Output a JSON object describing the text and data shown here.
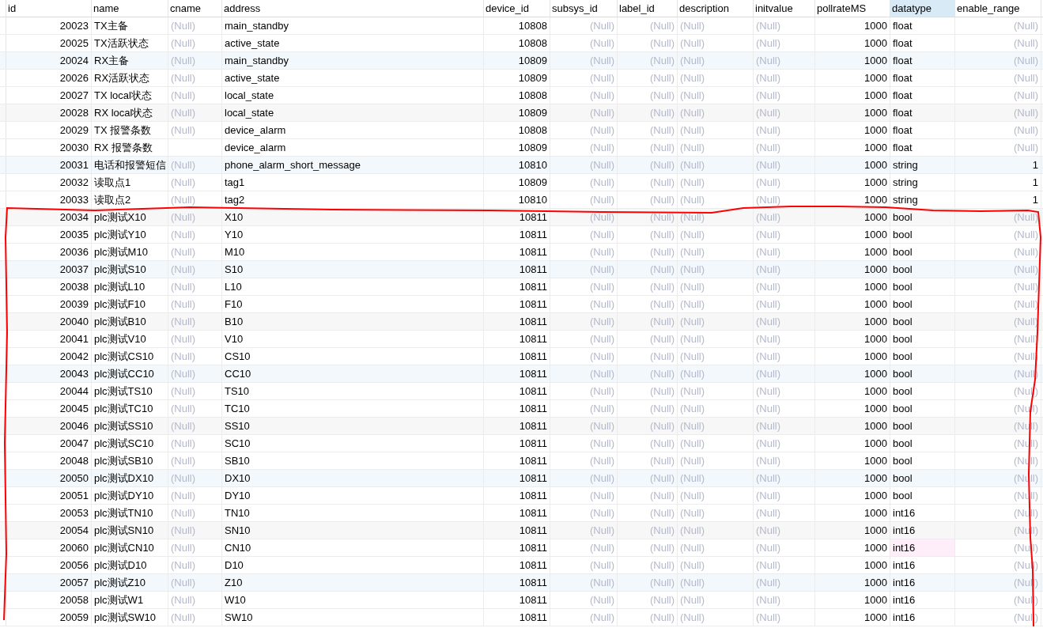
{
  "table": {
    "columns": [
      {
        "label": "id",
        "selected": false
      },
      {
        "label": "name",
        "selected": false
      },
      {
        "label": "cname",
        "selected": false
      },
      {
        "label": "address",
        "selected": false
      },
      {
        "label": "device_id",
        "selected": false
      },
      {
        "label": "subsys_id",
        "selected": false
      },
      {
        "label": "label_id",
        "selected": false
      },
      {
        "label": "description",
        "selected": false
      },
      {
        "label": "initvalue",
        "selected": false
      },
      {
        "label": "pollrateMS",
        "selected": false
      },
      {
        "label": "datatype",
        "selected": true
      },
      {
        "label": "enable_range",
        "selected": false
      }
    ],
    "rows": [
      {
        "cells": [
          "20023",
          "TX主备",
          "(Null)",
          "main_standby",
          "10808",
          "(Null)",
          "(Null)",
          "(Null)",
          "(Null)",
          "1000",
          "float",
          "(Null)"
        ],
        "nulls": [
          false,
          false,
          true,
          false,
          false,
          true,
          true,
          true,
          true,
          false,
          false,
          true
        ],
        "modified": false
      },
      {
        "cells": [
          "20025",
          "TX活跃状态",
          "(Null)",
          "active_state",
          "10808",
          "(Null)",
          "(Null)",
          "(Null)",
          "(Null)",
          "1000",
          "float",
          "(Null)"
        ],
        "nulls": [
          false,
          false,
          true,
          false,
          false,
          true,
          true,
          true,
          true,
          false,
          false,
          true
        ],
        "modified": false
      },
      {
        "cells": [
          "20024",
          "RX主备",
          "(Null)",
          "main_standby",
          "10809",
          "(Null)",
          "(Null)",
          "(Null)",
          "(Null)",
          "1000",
          "float",
          "(Null)"
        ],
        "nulls": [
          false,
          false,
          true,
          false,
          false,
          true,
          true,
          true,
          true,
          false,
          false,
          true
        ],
        "modified": false
      },
      {
        "cells": [
          "20026",
          "RX活跃状态",
          "(Null)",
          "active_state",
          "10809",
          "(Null)",
          "(Null)",
          "(Null)",
          "(Null)",
          "1000",
          "float",
          "(Null)"
        ],
        "nulls": [
          false,
          false,
          true,
          false,
          false,
          true,
          true,
          true,
          true,
          false,
          false,
          true
        ],
        "modified": false
      },
      {
        "cells": [
          "20027",
          "TX local状态",
          "(Null)",
          "local_state",
          "10808",
          "(Null)",
          "(Null)",
          "(Null)",
          "(Null)",
          "1000",
          "float",
          "(Null)"
        ],
        "nulls": [
          false,
          false,
          true,
          false,
          false,
          true,
          true,
          true,
          true,
          false,
          false,
          true
        ],
        "modified": false
      },
      {
        "cells": [
          "20028",
          "RX local状态",
          "(Null)",
          "local_state",
          "10809",
          "(Null)",
          "(Null)",
          "(Null)",
          "(Null)",
          "1000",
          "float",
          "(Null)"
        ],
        "nulls": [
          false,
          false,
          true,
          false,
          false,
          true,
          true,
          true,
          true,
          false,
          false,
          true
        ],
        "modified": false
      },
      {
        "cells": [
          "20029",
          "TX 报警条数",
          "(Null)",
          "device_alarm",
          "10808",
          "(Null)",
          "(Null)",
          "(Null)",
          "(Null)",
          "1000",
          "float",
          "(Null)"
        ],
        "nulls": [
          false,
          false,
          true,
          false,
          false,
          true,
          true,
          true,
          true,
          false,
          false,
          true
        ],
        "modified": false
      },
      {
        "cells": [
          "20030",
          "RX 报警条数",
          null,
          "device_alarm",
          "10809",
          "(Null)",
          "(Null)",
          "(Null)",
          "(Null)",
          "1000",
          "float",
          "(Null)"
        ],
        "nulls": [
          false,
          false,
          false,
          false,
          false,
          true,
          true,
          true,
          true,
          false,
          false,
          true
        ],
        "modified": false
      },
      {
        "cells": [
          "20031",
          "电话和报警短信",
          "(Null)",
          "phone_alarm_short_message",
          "10810",
          "(Null)",
          "(Null)",
          "(Null)",
          "(Null)",
          "1000",
          "string",
          "1"
        ],
        "nulls": [
          false,
          false,
          true,
          false,
          false,
          true,
          true,
          true,
          true,
          false,
          false,
          false
        ],
        "modified": false
      },
      {
        "cells": [
          "20032",
          "读取点1",
          "(Null)",
          "tag1",
          "10809",
          "(Null)",
          "(Null)",
          "(Null)",
          "(Null)",
          "1000",
          "string",
          "1"
        ],
        "nulls": [
          false,
          false,
          true,
          false,
          false,
          true,
          true,
          true,
          true,
          false,
          false,
          false
        ],
        "modified": false
      },
      {
        "cells": [
          "20033",
          "读取点2",
          "(Null)",
          "tag2",
          "10810",
          "(Null)",
          "(Null)",
          "(Null)",
          "(Null)",
          "1000",
          "string",
          "1"
        ],
        "nulls": [
          false,
          false,
          true,
          false,
          false,
          true,
          true,
          true,
          true,
          false,
          false,
          false
        ],
        "modified": false
      },
      {
        "cells": [
          "20034",
          "plc测试X10",
          "(Null)",
          "X10",
          "10811",
          "(Null)",
          "(Null)",
          "(Null)",
          "(Null)",
          "1000",
          "bool",
          "(Null)"
        ],
        "nulls": [
          false,
          false,
          true,
          false,
          false,
          true,
          true,
          true,
          true,
          false,
          false,
          true
        ],
        "modified": false
      },
      {
        "cells": [
          "20035",
          "plc测试Y10",
          "(Null)",
          "Y10",
          "10811",
          "(Null)",
          "(Null)",
          "(Null)",
          "(Null)",
          "1000",
          "bool",
          "(Null)"
        ],
        "nulls": [
          false,
          false,
          true,
          false,
          false,
          true,
          true,
          true,
          true,
          false,
          false,
          true
        ],
        "modified": false
      },
      {
        "cells": [
          "20036",
          "plc测试M10",
          "(Null)",
          "M10",
          "10811",
          "(Null)",
          "(Null)",
          "(Null)",
          "(Null)",
          "1000",
          "bool",
          "(Null)"
        ],
        "nulls": [
          false,
          false,
          true,
          false,
          false,
          true,
          true,
          true,
          true,
          false,
          false,
          true
        ],
        "modified": false
      },
      {
        "cells": [
          "20037",
          "plc测试S10",
          "(Null)",
          "S10",
          "10811",
          "(Null)",
          "(Null)",
          "(Null)",
          "(Null)",
          "1000",
          "bool",
          "(Null)"
        ],
        "nulls": [
          false,
          false,
          true,
          false,
          false,
          true,
          true,
          true,
          true,
          false,
          false,
          true
        ],
        "modified": false
      },
      {
        "cells": [
          "20038",
          "plc测试L10",
          "(Null)",
          "L10",
          "10811",
          "(Null)",
          "(Null)",
          "(Null)",
          "(Null)",
          "1000",
          "bool",
          "(Null)"
        ],
        "nulls": [
          false,
          false,
          true,
          false,
          false,
          true,
          true,
          true,
          true,
          false,
          false,
          true
        ],
        "modified": false
      },
      {
        "cells": [
          "20039",
          "plc测试F10",
          "(Null)",
          "F10",
          "10811",
          "(Null)",
          "(Null)",
          "(Null)",
          "(Null)",
          "1000",
          "bool",
          "(Null)"
        ],
        "nulls": [
          false,
          false,
          true,
          false,
          false,
          true,
          true,
          true,
          true,
          false,
          false,
          true
        ],
        "modified": false
      },
      {
        "cells": [
          "20040",
          "plc测试B10",
          "(Null)",
          "B10",
          "10811",
          "(Null)",
          "(Null)",
          "(Null)",
          "(Null)",
          "1000",
          "bool",
          "(Null)"
        ],
        "nulls": [
          false,
          false,
          true,
          false,
          false,
          true,
          true,
          true,
          true,
          false,
          false,
          true
        ],
        "modified": false
      },
      {
        "cells": [
          "20041",
          "plc测试V10",
          "(Null)",
          "V10",
          "10811",
          "(Null)",
          "(Null)",
          "(Null)",
          "(Null)",
          "1000",
          "bool",
          "(Null)"
        ],
        "nulls": [
          false,
          false,
          true,
          false,
          false,
          true,
          true,
          true,
          true,
          false,
          false,
          true
        ],
        "modified": false
      },
      {
        "cells": [
          "20042",
          "plc测试CS10",
          "(Null)",
          "CS10",
          "10811",
          "(Null)",
          "(Null)",
          "(Null)",
          "(Null)",
          "1000",
          "bool",
          "(Null)"
        ],
        "nulls": [
          false,
          false,
          true,
          false,
          false,
          true,
          true,
          true,
          true,
          false,
          false,
          true
        ],
        "modified": false
      },
      {
        "cells": [
          "20043",
          "plc测试CC10",
          "(Null)",
          "CC10",
          "10811",
          "(Null)",
          "(Null)",
          "(Null)",
          "(Null)",
          "1000",
          "bool",
          "(Null)"
        ],
        "nulls": [
          false,
          false,
          true,
          false,
          false,
          true,
          true,
          true,
          true,
          false,
          false,
          true
        ],
        "modified": false
      },
      {
        "cells": [
          "20044",
          "plc测试TS10",
          "(Null)",
          "TS10",
          "10811",
          "(Null)",
          "(Null)",
          "(Null)",
          "(Null)",
          "1000",
          "bool",
          "(Null)"
        ],
        "nulls": [
          false,
          false,
          true,
          false,
          false,
          true,
          true,
          true,
          true,
          false,
          false,
          true
        ],
        "modified": false
      },
      {
        "cells": [
          "20045",
          "plc测试TC10",
          "(Null)",
          "TC10",
          "10811",
          "(Null)",
          "(Null)",
          "(Null)",
          "(Null)",
          "1000",
          "bool",
          "(Null)"
        ],
        "nulls": [
          false,
          false,
          true,
          false,
          false,
          true,
          true,
          true,
          true,
          false,
          false,
          true
        ],
        "modified": false
      },
      {
        "cells": [
          "20046",
          "plc测试SS10",
          "(Null)",
          "SS10",
          "10811",
          "(Null)",
          "(Null)",
          "(Null)",
          "(Null)",
          "1000",
          "bool",
          "(Null)"
        ],
        "nulls": [
          false,
          false,
          true,
          false,
          false,
          true,
          true,
          true,
          true,
          false,
          false,
          true
        ],
        "modified": false
      },
      {
        "cells": [
          "20047",
          "plc测试SC10",
          "(Null)",
          "SC10",
          "10811",
          "(Null)",
          "(Null)",
          "(Null)",
          "(Null)",
          "1000",
          "bool",
          "(Null)"
        ],
        "nulls": [
          false,
          false,
          true,
          false,
          false,
          true,
          true,
          true,
          true,
          false,
          false,
          true
        ],
        "modified": false
      },
      {
        "cells": [
          "20048",
          "plc测试SB10",
          "(Null)",
          "SB10",
          "10811",
          "(Null)",
          "(Null)",
          "(Null)",
          "(Null)",
          "1000",
          "bool",
          "(Null)"
        ],
        "nulls": [
          false,
          false,
          true,
          false,
          false,
          true,
          true,
          true,
          true,
          false,
          false,
          true
        ],
        "modified": false
      },
      {
        "cells": [
          "20050",
          "plc测试DX10",
          "(Null)",
          "DX10",
          "10811",
          "(Null)",
          "(Null)",
          "(Null)",
          "(Null)",
          "1000",
          "bool",
          "(Null)"
        ],
        "nulls": [
          false,
          false,
          true,
          false,
          false,
          true,
          true,
          true,
          true,
          false,
          false,
          true
        ],
        "modified": false
      },
      {
        "cells": [
          "20051",
          "plc测试DY10",
          "(Null)",
          "DY10",
          "10811",
          "(Null)",
          "(Null)",
          "(Null)",
          "(Null)",
          "1000",
          "bool",
          "(Null)"
        ],
        "nulls": [
          false,
          false,
          true,
          false,
          false,
          true,
          true,
          true,
          true,
          false,
          false,
          true
        ],
        "modified": false
      },
      {
        "cells": [
          "20053",
          "plc测试TN10",
          "(Null)",
          "TN10",
          "10811",
          "(Null)",
          "(Null)",
          "(Null)",
          "(Null)",
          "1000",
          "int16",
          "(Null)"
        ],
        "nulls": [
          false,
          false,
          true,
          false,
          false,
          true,
          true,
          true,
          true,
          false,
          false,
          true
        ],
        "modified": false
      },
      {
        "cells": [
          "20054",
          "plc测试SN10",
          "(Null)",
          "SN10",
          "10811",
          "(Null)",
          "(Null)",
          "(Null)",
          "(Null)",
          "1000",
          "int16",
          "(Null)"
        ],
        "nulls": [
          false,
          false,
          true,
          false,
          false,
          true,
          true,
          true,
          true,
          false,
          false,
          true
        ],
        "modified": false
      },
      {
        "cells": [
          "20060",
          "plc测试CN10",
          "(Null)",
          "CN10",
          "10811",
          "(Null)",
          "(Null)",
          "(Null)",
          "(Null)",
          "1000",
          "int16",
          "(Null)"
        ],
        "nulls": [
          false,
          false,
          true,
          false,
          false,
          true,
          true,
          true,
          true,
          false,
          false,
          true
        ],
        "modified": true
      },
      {
        "cells": [
          "20056",
          "plc测试D10",
          "(Null)",
          "D10",
          "10811",
          "(Null)",
          "(Null)",
          "(Null)",
          "(Null)",
          "1000",
          "int16",
          "(Null)"
        ],
        "nulls": [
          false,
          false,
          true,
          false,
          false,
          true,
          true,
          true,
          true,
          false,
          false,
          true
        ],
        "modified": false
      },
      {
        "cells": [
          "20057",
          "plc测试Z10",
          "(Null)",
          "Z10",
          "10811",
          "(Null)",
          "(Null)",
          "(Null)",
          "(Null)",
          "1000",
          "int16",
          "(Null)"
        ],
        "nulls": [
          false,
          false,
          true,
          false,
          false,
          true,
          true,
          true,
          true,
          false,
          false,
          true
        ],
        "modified": false
      },
      {
        "cells": [
          "20058",
          "plc测试W1",
          "(Null)",
          "W10",
          "10811",
          "(Null)",
          "(Null)",
          "(Null)",
          "(Null)",
          "1000",
          "int16",
          "(Null)"
        ],
        "nulls": [
          false,
          false,
          true,
          false,
          false,
          true,
          true,
          true,
          true,
          false,
          false,
          true
        ],
        "modified": false
      },
      {
        "cells": [
          "20059",
          "plc测试SW10",
          "(Null)",
          "SW10",
          "10811",
          "(Null)",
          "(Null)",
          "(Null)",
          "(Null)",
          "1000",
          "int16",
          "(Null)"
        ],
        "nulls": [
          false,
          false,
          true,
          false,
          false,
          true,
          true,
          true,
          true,
          false,
          false,
          true
        ],
        "modified": false
      }
    ]
  },
  "annotation": {
    "kind": "freehand-outline"
  }
}
